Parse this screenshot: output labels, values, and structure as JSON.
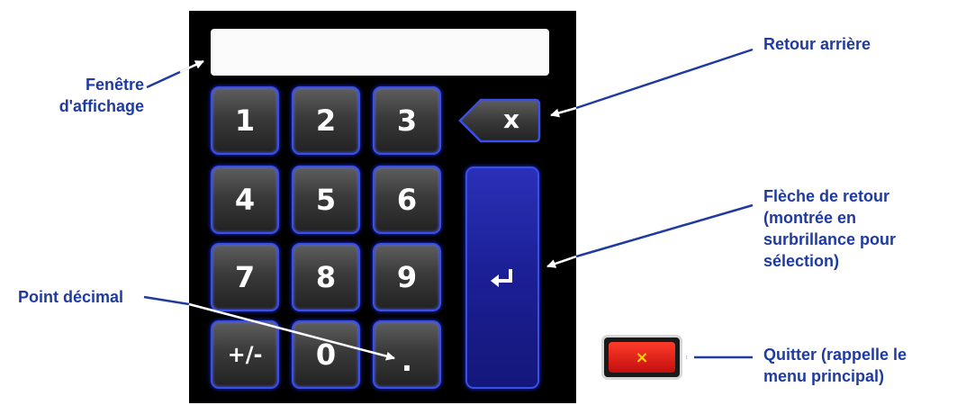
{
  "keypad": {
    "rows": [
      [
        "1",
        "2",
        "3"
      ],
      [
        "4",
        "5",
        "6"
      ],
      [
        "7",
        "8",
        "9"
      ],
      [
        "+/-",
        "0",
        "."
      ]
    ],
    "backspace_label": "x",
    "enter_icon": "return-arrow-icon",
    "quit_label": "×",
    "quit_icon": "close-icon"
  },
  "callouts": {
    "display_window": [
      "Fenêtre",
      "d'affichage"
    ],
    "backspace": [
      "Retour arrière"
    ],
    "enter": [
      "Flèche de retour",
      "(montrée en",
      "surbrillance pour",
      "sélection)"
    ],
    "decimal": [
      "Point décimal"
    ],
    "quit": [
      "Quitter (rappelle le",
      "menu principal)"
    ]
  },
  "colors": {
    "callout_text": "#1f3ba0",
    "key_border": "#3a4fe8",
    "enter_fill": "#1b1f94",
    "quit_fill": "#d9151a",
    "quit_icon": "#ffd400"
  }
}
